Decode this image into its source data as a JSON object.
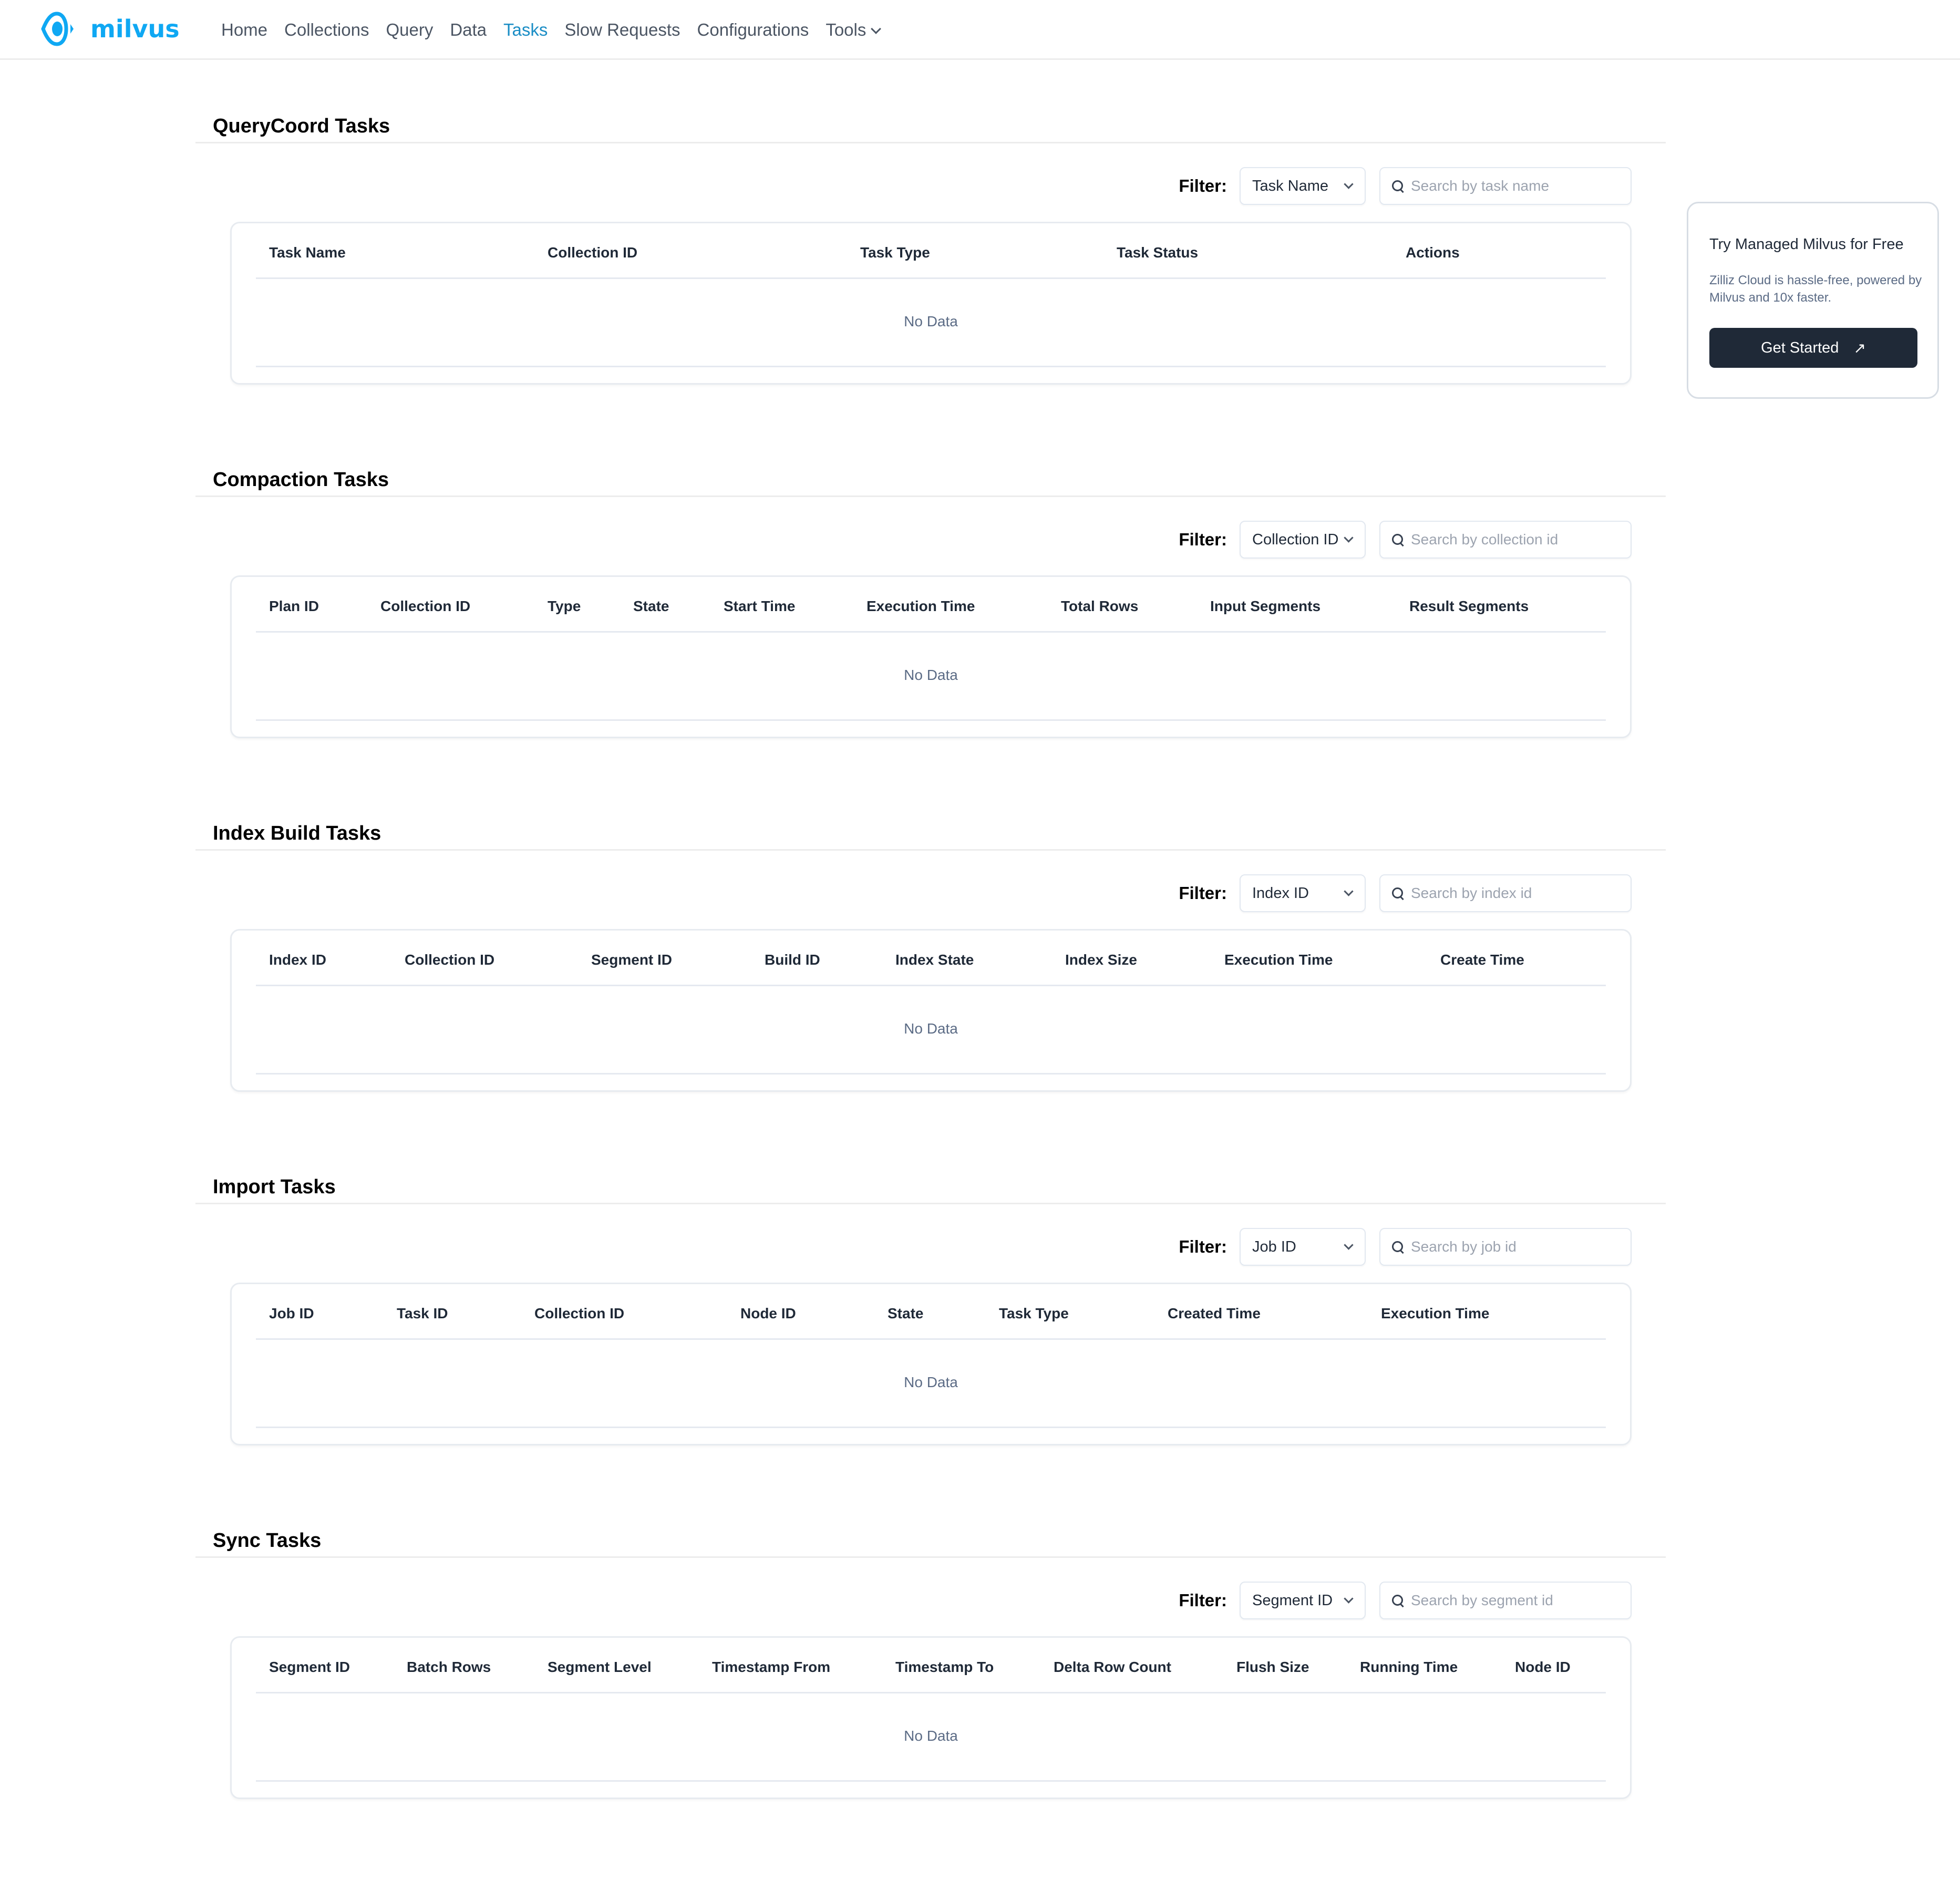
{
  "brand": {
    "name": "milvus",
    "color": "#0fa8f3",
    "logo_icon": "milvus-eye-icon"
  },
  "nav": {
    "items": [
      {
        "label": "Home",
        "active": false
      },
      {
        "label": "Collections",
        "active": false
      },
      {
        "label": "Query",
        "active": false
      },
      {
        "label": "Data",
        "active": false
      },
      {
        "label": "Tasks",
        "active": true
      },
      {
        "label": "Slow Requests",
        "active": false
      },
      {
        "label": "Configurations",
        "active": false
      },
      {
        "label": "Tools",
        "active": false,
        "dropdown": true
      }
    ],
    "active_color": "#1a8dc5"
  },
  "filter_label": "Filter:",
  "no_data": "No Data",
  "sections": [
    {
      "title": "QueryCoord Tasks",
      "filter_select": "Task Name",
      "search_placeholder": "Search by task name",
      "columns": [
        "Task Name",
        "Collection ID",
        "Task Type",
        "Task Status",
        "Actions"
      ],
      "rows": []
    },
    {
      "title": "Compaction Tasks",
      "filter_select": "Collection ID",
      "search_placeholder": "Search by collection id",
      "columns": [
        "Plan ID",
        "Collection ID",
        "Type",
        "State",
        "Start Time",
        "Execution Time",
        "Total Rows",
        "Input Segments",
        "Result Segments"
      ],
      "rows": []
    },
    {
      "title": "Index Build Tasks",
      "filter_select": "Index ID",
      "search_placeholder": "Search by index id",
      "columns": [
        "Index ID",
        "Collection ID",
        "Segment ID",
        "Build ID",
        "Index State",
        "Index Size",
        "Execution Time",
        "Create Time"
      ],
      "rows": []
    },
    {
      "title": "Import Tasks",
      "filter_select": "Job ID",
      "search_placeholder": "Search by job id",
      "columns": [
        "Job ID",
        "Task ID",
        "Collection ID",
        "Node ID",
        "State",
        "Task Type",
        "Created Time",
        "Execution Time"
      ],
      "rows": []
    },
    {
      "title": "Sync Tasks",
      "filter_select": "Segment ID",
      "search_placeholder": "Search by segment id",
      "columns": [
        "Segment ID",
        "Batch Rows",
        "Segment Level",
        "Timestamp From",
        "Timestamp To",
        "Delta Row Count",
        "Flush Size",
        "Running Time",
        "Node ID"
      ],
      "rows": []
    }
  ],
  "promo": {
    "title": "Try Managed Milvus for Free",
    "description": "Zilliz Cloud is hassle-free, powered by Milvus and 10x faster.",
    "button_label": "Get Started",
    "button_icon": "external-arrow-icon",
    "button_color": "#1f2937"
  }
}
